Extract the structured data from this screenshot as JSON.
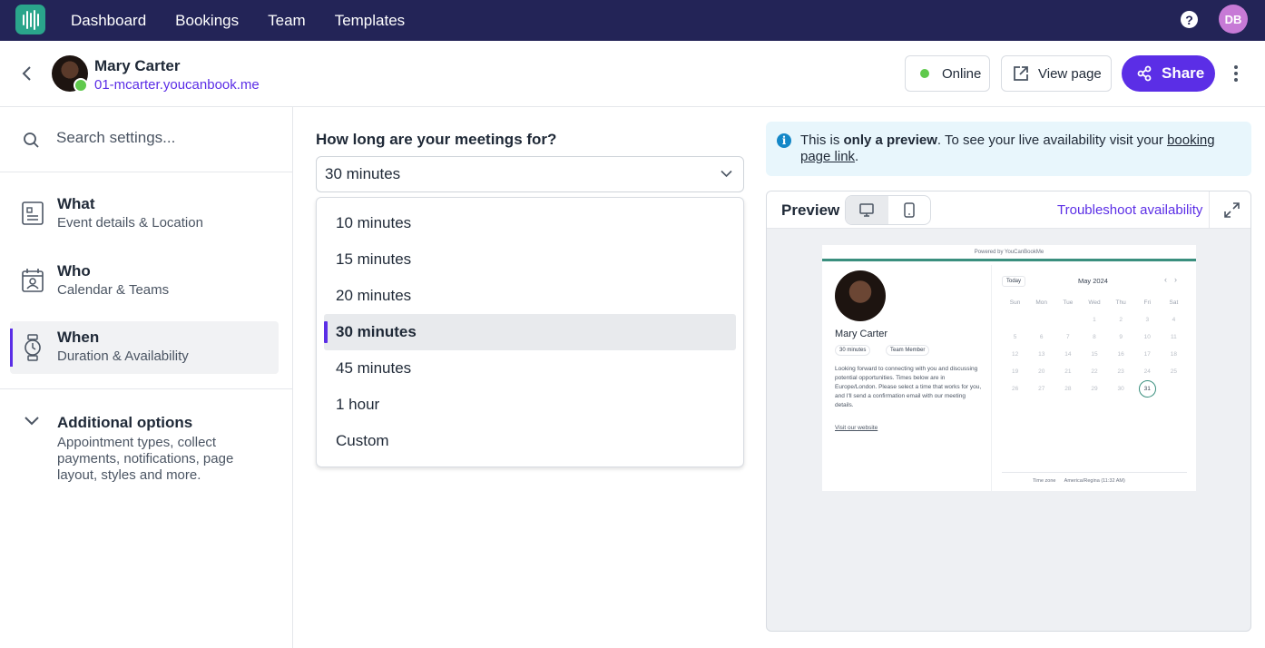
{
  "nav": {
    "items": [
      "Dashboard",
      "Bookings",
      "Team",
      "Templates"
    ],
    "help_label": "?",
    "user_initials": "DB"
  },
  "header": {
    "name": "Mary Carter",
    "url": "01-mcarter.youcanbook.me",
    "online_label": "Online",
    "view_page_label": "View page",
    "share_label": "Share"
  },
  "sidebar": {
    "search_placeholder": "Search settings...",
    "items": [
      {
        "title": "What",
        "subtitle": "Event details & Location"
      },
      {
        "title": "Who",
        "subtitle": "Calendar & Teams"
      },
      {
        "title": "When",
        "subtitle": "Duration & Availability"
      }
    ],
    "additional": {
      "title": "Additional options",
      "subtitle": "Appointment types, collect payments, notifications, page layout, styles and more."
    }
  },
  "duration": {
    "question": "How long are your meetings for?",
    "selected": "30 minutes",
    "options": [
      "10 minutes",
      "15 minutes",
      "20 minutes",
      "30 minutes",
      "45 minutes",
      "1 hour",
      "Custom"
    ]
  },
  "info": {
    "part1": "This is ",
    "bold": "only a preview",
    "part2": ". To see your live availability visit your ",
    "link": "booking page link",
    "part3": "."
  },
  "preview": {
    "title": "Preview",
    "troubleshoot_label": "Troubleshoot availability",
    "mini": {
      "powered": "Powered by YouCanBookMe",
      "name": "Mary Carter",
      "duration_chip": "30 minutes",
      "role_chip": "Team Member",
      "description": "Looking forward to connecting with you and discussing potential opportunities. Times below are in Europe/London. Please select a time that works for you, and I'll send a confirmation email with our meeting details.",
      "website_link": "Visit our website",
      "today_label": "Today",
      "month": "May 2024",
      "weekdays": [
        "Sun",
        "Mon",
        "Tue",
        "Wed",
        "Thu",
        "Fri",
        "Sat"
      ],
      "days": [
        "",
        "",
        "",
        "1",
        "2",
        "3",
        "4",
        "5",
        "6",
        "7",
        "8",
        "9",
        "10",
        "11",
        "12",
        "13",
        "14",
        "15",
        "16",
        "17",
        "18",
        "19",
        "20",
        "21",
        "22",
        "23",
        "24",
        "25",
        "26",
        "27",
        "28",
        "29",
        "30",
        "31",
        ""
      ],
      "timezone_label": "Time zone",
      "timezone_value": "America/Regina (11:32 AM)"
    }
  }
}
